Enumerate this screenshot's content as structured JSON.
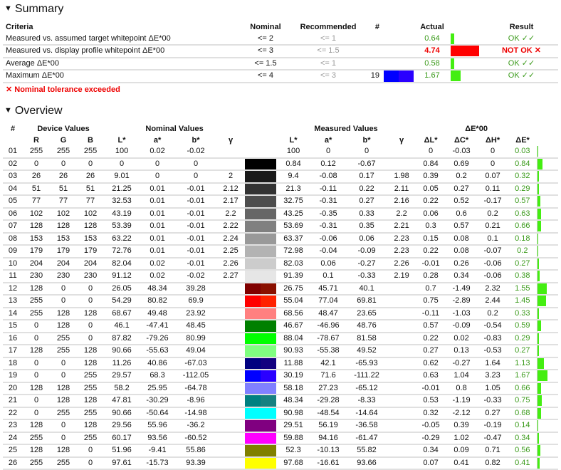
{
  "summary": {
    "title": "Summary",
    "headers": [
      "Criteria",
      "Nominal",
      "Recommended",
      "#",
      "Actual",
      "Result"
    ],
    "rows": [
      {
        "criteria": "Measured vs. assumed target whitepoint ΔE*00",
        "nominal": "<= 2",
        "recommended": "<= 1",
        "num": "",
        "actual": "0.64",
        "result": "OK ✓✓",
        "ok": true
      },
      {
        "criteria": "Measured vs. display profile whitepoint ΔE*00",
        "nominal": "<= 3",
        "recommended": "<= 1.5",
        "num": "",
        "actual": "4.74",
        "result": "NOT OK ✕",
        "ok": false
      },
      {
        "criteria": "Average ΔE*00",
        "nominal": "<= 1.5",
        "recommended": "<= 1",
        "num": "",
        "actual": "0.58",
        "result": "OK ✓✓",
        "ok": true
      },
      {
        "criteria": "Maximum ΔE*00",
        "nominal": "<= 4",
        "recommended": "<= 3",
        "num": "19",
        "actual": "1.67",
        "result": "OK ✓✓",
        "ok": true
      }
    ],
    "note": "✕ Nominal tolerance exceeded"
  },
  "overview": {
    "title": "Overview",
    "group_headers": [
      "#",
      "Device Values",
      "Nominal Values",
      "Measured Values",
      "ΔE*00"
    ],
    "sub_headers": {
      "device": [
        "R",
        "G",
        "B"
      ],
      "nominal": [
        "L*",
        "a*",
        "b*",
        "γ"
      ],
      "measured": [
        "L*",
        "a*",
        "b*",
        "γ"
      ],
      "delta": [
        "ΔL*",
        "ΔC*",
        "ΔH*",
        "ΔE*"
      ]
    },
    "rows": [
      [
        "01",
        "255",
        "255",
        "255",
        "100",
        "0.02",
        "-0.02",
        "",
        "100",
        "0",
        "0",
        "",
        "0",
        "-0.03",
        "0",
        "0.03"
      ],
      [
        "02",
        "0",
        "0",
        "0",
        "0",
        "0",
        "0",
        "",
        "0.84",
        "0.12",
        "-0.67",
        "",
        "0.84",
        "0.69",
        "0",
        "0.84"
      ],
      [
        "03",
        "26",
        "26",
        "26",
        "9.01",
        "0",
        "0",
        "2",
        "9.4",
        "-0.08",
        "0.17",
        "1.98",
        "0.39",
        "0.2",
        "0.07",
        "0.32"
      ],
      [
        "04",
        "51",
        "51",
        "51",
        "21.25",
        "0.01",
        "-0.01",
        "2.12",
        "21.3",
        "-0.11",
        "0.22",
        "2.11",
        "0.05",
        "0.27",
        "0.11",
        "0.29"
      ],
      [
        "05",
        "77",
        "77",
        "77",
        "32.53",
        "0.01",
        "-0.01",
        "2.17",
        "32.75",
        "-0.31",
        "0.27",
        "2.16",
        "0.22",
        "0.52",
        "-0.17",
        "0.57"
      ],
      [
        "06",
        "102",
        "102",
        "102",
        "43.19",
        "0.01",
        "-0.01",
        "2.2",
        "43.25",
        "-0.35",
        "0.33",
        "2.2",
        "0.06",
        "0.6",
        "0.2",
        "0.63"
      ],
      [
        "07",
        "128",
        "128",
        "128",
        "53.39",
        "0.01",
        "-0.01",
        "2.22",
        "53.69",
        "-0.31",
        "0.35",
        "2.21",
        "0.3",
        "0.57",
        "0.21",
        "0.66"
      ],
      [
        "08",
        "153",
        "153",
        "153",
        "63.22",
        "0.01",
        "-0.01",
        "2.24",
        "63.37",
        "-0.06",
        "0.06",
        "2.23",
        "0.15",
        "0.08",
        "0.1",
        "0.18"
      ],
      [
        "09",
        "179",
        "179",
        "179",
        "72.76",
        "0.01",
        "-0.01",
        "2.25",
        "72.98",
        "-0.04",
        "-0.09",
        "2.23",
        "0.22",
        "0.08",
        "-0.07",
        "0.2"
      ],
      [
        "10",
        "204",
        "204",
        "204",
        "82.04",
        "0.02",
        "-0.01",
        "2.26",
        "82.03",
        "0.06",
        "-0.27",
        "2.26",
        "-0.01",
        "0.26",
        "-0.06",
        "0.27"
      ],
      [
        "11",
        "230",
        "230",
        "230",
        "91.12",
        "0.02",
        "-0.02",
        "2.27",
        "91.39",
        "0.1",
        "-0.33",
        "2.19",
        "0.28",
        "0.34",
        "-0.06",
        "0.38"
      ],
      [
        "12",
        "128",
        "0",
        "0",
        "26.05",
        "48.34",
        "39.28",
        "",
        "26.75",
        "45.71",
        "40.1",
        "",
        "0.7",
        "-1.49",
        "2.32",
        "1.55"
      ],
      [
        "13",
        "255",
        "0",
        "0",
        "54.29",
        "80.82",
        "69.9",
        "",
        "55.04",
        "77.04",
        "69.81",
        "",
        "0.75",
        "-2.89",
        "2.44",
        "1.45"
      ],
      [
        "14",
        "255",
        "128",
        "128",
        "68.67",
        "49.48",
        "23.92",
        "",
        "68.56",
        "48.47",
        "23.65",
        "",
        "-0.11",
        "-1.03",
        "0.2",
        "0.33"
      ],
      [
        "15",
        "0",
        "128",
        "0",
        "46.1",
        "-47.41",
        "48.45",
        "",
        "46.67",
        "-46.96",
        "48.76",
        "",
        "0.57",
        "-0.09",
        "-0.54",
        "0.59"
      ],
      [
        "16",
        "0",
        "255",
        "0",
        "87.82",
        "-79.26",
        "80.99",
        "",
        "88.04",
        "-78.67",
        "81.58",
        "",
        "0.22",
        "0.02",
        "-0.83",
        "0.29"
      ],
      [
        "17",
        "128",
        "255",
        "128",
        "90.66",
        "-55.63",
        "49.04",
        "",
        "90.93",
        "-55.38",
        "49.52",
        "",
        "0.27",
        "0.13",
        "-0.53",
        "0.27"
      ],
      [
        "18",
        "0",
        "0",
        "128",
        "11.26",
        "40.86",
        "-67.03",
        "",
        "11.88",
        "42.1",
        "-65.93",
        "",
        "0.62",
        "-0.27",
        "1.64",
        "1.13"
      ],
      [
        "19",
        "0",
        "0",
        "255",
        "29.57",
        "68.3",
        "-112.05",
        "",
        "30.19",
        "71.6",
        "-111.22",
        "",
        "0.63",
        "1.04",
        "3.23",
        "1.67"
      ],
      [
        "20",
        "128",
        "128",
        "255",
        "58.2",
        "25.95",
        "-64.78",
        "",
        "58.18",
        "27.23",
        "-65.12",
        "",
        "-0.01",
        "0.8",
        "1.05",
        "0.66"
      ],
      [
        "21",
        "0",
        "128",
        "128",
        "47.81",
        "-30.29",
        "-8.96",
        "",
        "48.34",
        "-29.28",
        "-8.33",
        "",
        "0.53",
        "-1.19",
        "-0.33",
        "0.75"
      ],
      [
        "22",
        "0",
        "255",
        "255",
        "90.66",
        "-50.64",
        "-14.98",
        "",
        "90.98",
        "-48.54",
        "-14.64",
        "",
        "0.32",
        "-2.12",
        "0.27",
        "0.68"
      ],
      [
        "23",
        "128",
        "0",
        "128",
        "29.56",
        "55.96",
        "-36.2",
        "",
        "29.51",
        "56.19",
        "-36.58",
        "",
        "-0.05",
        "0.39",
        "-0.19",
        "0.14"
      ],
      [
        "24",
        "255",
        "0",
        "255",
        "60.17",
        "93.56",
        "-60.52",
        "",
        "59.88",
        "94.16",
        "-61.47",
        "",
        "-0.29",
        "1.02",
        "-0.47",
        "0.34"
      ],
      [
        "25",
        "128",
        "128",
        "0",
        "51.96",
        "-9.41",
        "55.86",
        "",
        "52.3",
        "-10.13",
        "55.82",
        "",
        "0.34",
        "0.09",
        "0.71",
        "0.56"
      ],
      [
        "26",
        "255",
        "255",
        "0",
        "97.61",
        "-15.73",
        "93.39",
        "",
        "97.68",
        "-16.61",
        "93.66",
        "",
        "0.07",
        "0.41",
        "0.82",
        "0.41"
      ]
    ]
  },
  "colors": {
    "ok": "#3a9a1a",
    "error": "#ee0000",
    "bar_ok": "#44ee11",
    "bar_bad": "#ff0000",
    "max_patch": "#0000ff"
  }
}
